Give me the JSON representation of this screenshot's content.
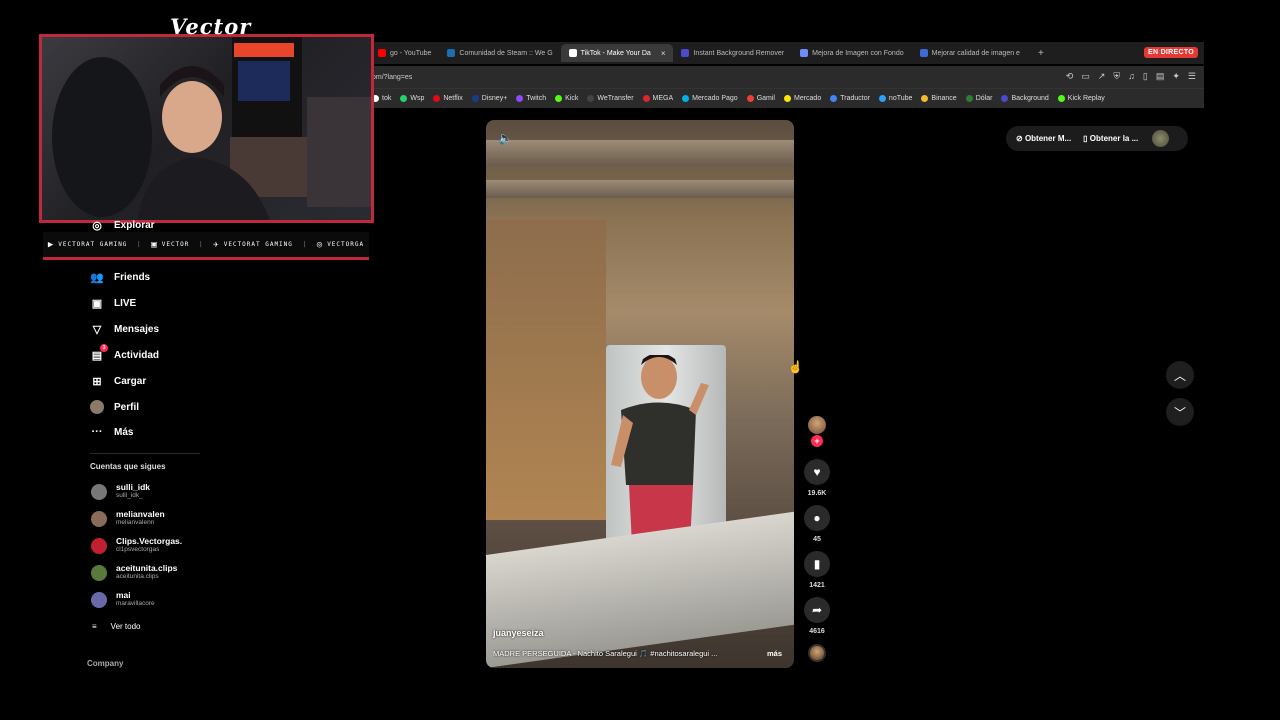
{
  "overlay": {
    "title": "Vector",
    "socials": [
      {
        "icon": "youtube-icon",
        "label": "VECTORAT GAMING"
      },
      {
        "icon": "chat-icon",
        "label": "VECTOR"
      },
      {
        "icon": "twitter-icon",
        "label": "VECTORAT GAMING"
      },
      {
        "icon": "instagram-icon",
        "label": "VECTORGA"
      }
    ]
  },
  "browser": {
    "tabs": [
      {
        "label": "go - YouTube",
        "icon": "youtube-icon",
        "color": "#ff0000",
        "active": false
      },
      {
        "label": "Comunidad de Steam :: We G",
        "icon": "steam-icon",
        "color": "#1b6fb0",
        "active": false
      },
      {
        "label": "TikTok - Make Your Da",
        "icon": "tiktok-icon",
        "color": "#ffffff",
        "active": true
      },
      {
        "label": "Instant Background Remover",
        "icon": "remover-icon",
        "color": "#4a4ad0",
        "active": false
      },
      {
        "label": "Mejora de Imagen con Fondo",
        "icon": "sparkle-icon",
        "color": "#6f8cff",
        "active": false
      },
      {
        "label": "Mejorar calidad de imagen e",
        "icon": "image-icon",
        "color": "#3e6ad8",
        "active": false
      }
    ],
    "live_badge": "EN DIRECTO",
    "url": "om/?lang=es",
    "bookmarks": [
      {
        "label": "tok",
        "color": "#ffffff"
      },
      {
        "label": "Wsp",
        "color": "#25d366"
      },
      {
        "label": "Netflix",
        "color": "#e50914"
      },
      {
        "label": "Disney+",
        "color": "#1a3b8c"
      },
      {
        "label": "Twitch",
        "color": "#9146ff"
      },
      {
        "label": "Kick",
        "color": "#53fc18"
      },
      {
        "label": "WeTransfer",
        "color": "#444444"
      },
      {
        "label": "MEGA",
        "color": "#d9272e"
      },
      {
        "label": "Mercado Pago",
        "color": "#00b1ea"
      },
      {
        "label": "Gamil",
        "color": "#ea4335"
      },
      {
        "label": "Mercado",
        "color": "#ffe600"
      },
      {
        "label": "Traductor",
        "color": "#4285f4"
      },
      {
        "label": "noTube",
        "color": "#2aa0ff"
      },
      {
        "label": "Binance",
        "color": "#f3ba2f"
      },
      {
        "label": "Dólar",
        "color": "#2e7d32"
      },
      {
        "label": "Background",
        "color": "#4a4ad0"
      },
      {
        "label": "Kick Replay",
        "color": "#53fc18"
      }
    ]
  },
  "sidebar": {
    "nav": [
      {
        "icon": "compass-icon",
        "label": "Explorar"
      },
      {
        "icon": "friends-icon",
        "label": "Friends"
      },
      {
        "icon": "live-icon",
        "label": "LIVE"
      },
      {
        "icon": "send-icon",
        "label": "Mensajes"
      },
      {
        "icon": "activity-icon",
        "label": "Actividad",
        "badge": "3"
      },
      {
        "icon": "upload-icon",
        "label": "Cargar"
      },
      {
        "icon": "avatar-icon",
        "label": "Perfil"
      },
      {
        "icon": "more-icon",
        "label": "Más"
      }
    ],
    "following_title": "Cuentas que sigues",
    "accounts": [
      {
        "name": "sulli_idk",
        "handle": "sulli_idk_",
        "color": "#777777"
      },
      {
        "name": "melianvalen",
        "handle": "melianvalenn",
        "color": "#8a6b5a"
      },
      {
        "name": "Clips.Vectorgas.",
        "handle": "cl1psvectorgas",
        "color": "#c02030"
      },
      {
        "name": "aceitunita.clips",
        "handle": "aceitunita.clips",
        "color": "#5a7a3a"
      },
      {
        "name": "mai",
        "handle": "maravillacore",
        "color": "#6a6aa8"
      }
    ],
    "see_all": "Ver todo",
    "company": "Company"
  },
  "video": {
    "username": "juanyeseiza",
    "caption": "MADRE PERSEGUIDA - Nachito Saralegui 🎵 #nachitosaralegui ...",
    "more": "más"
  },
  "actions": {
    "likes": "19.6K",
    "comments": "45",
    "saves": "1421",
    "shares": "4616"
  },
  "topright": {
    "btn1": "Obtener M...",
    "btn2": "Obtener la ..."
  }
}
